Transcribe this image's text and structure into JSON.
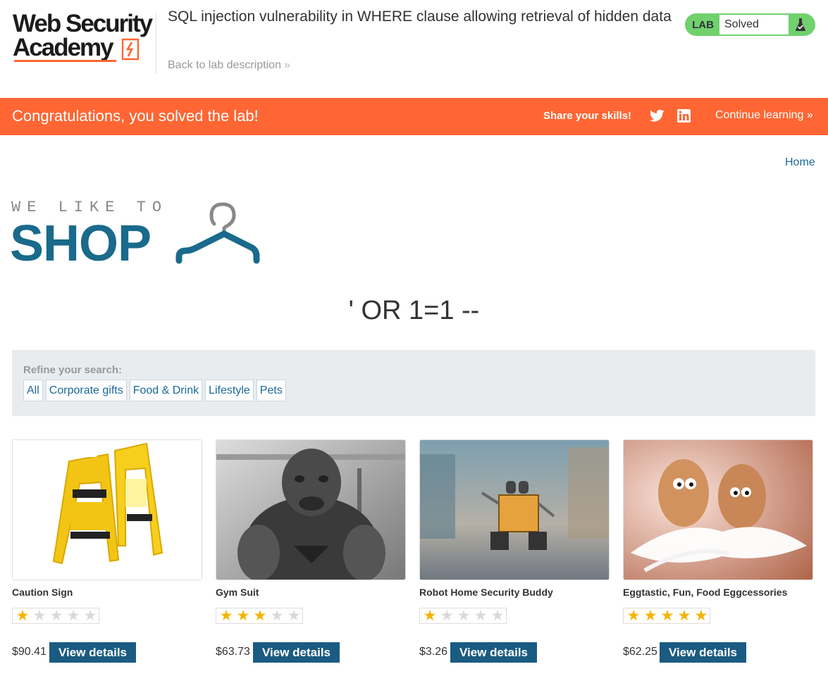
{
  "header": {
    "logo_line1": "Web Security",
    "logo_line2": "Academy",
    "lab_title": "SQL injection vulnerability in WHERE clause allowing retrieval of hidden data",
    "back_link": "Back to lab description",
    "lab_tag": "LAB",
    "lab_status": "Solved"
  },
  "banner": {
    "message": "Congratulations, you solved the lab!",
    "share": "Share your skills!",
    "continue": "Continue learning"
  },
  "nav": {
    "home": "Home"
  },
  "shop_logo": {
    "tagline": "WE LIKE TO",
    "word": "SHOP"
  },
  "search": {
    "term": "' OR 1=1 --"
  },
  "filters": {
    "label": "Refine your search:",
    "items": [
      "All",
      "Corporate gifts",
      "Food & Drink",
      "Lifestyle",
      "Pets"
    ]
  },
  "products": [
    {
      "name": "Caution Sign",
      "rating": 1,
      "price": "$90.41",
      "button": "View details"
    },
    {
      "name": "Gym Suit",
      "rating": 3,
      "price": "$63.73",
      "button": "View details"
    },
    {
      "name": "Robot Home Security Buddy",
      "rating": 1,
      "price": "$3.26",
      "button": "View details"
    },
    {
      "name": "Eggtastic, Fun, Food Eggcessories",
      "rating": 5,
      "price": "$62.25",
      "button": "View details"
    }
  ],
  "colors": {
    "accent": "#ff6633",
    "brand_blue": "#1a6a8b",
    "button": "#1a5b82",
    "solved_green": "#70d16d",
    "star": "#f5b400"
  },
  "icons": {
    "back": "chevron-double-right-icon",
    "flask": "flask-icon",
    "twitter": "twitter-icon",
    "linkedin": "linkedin-icon",
    "hanger": "hanger-icon"
  }
}
